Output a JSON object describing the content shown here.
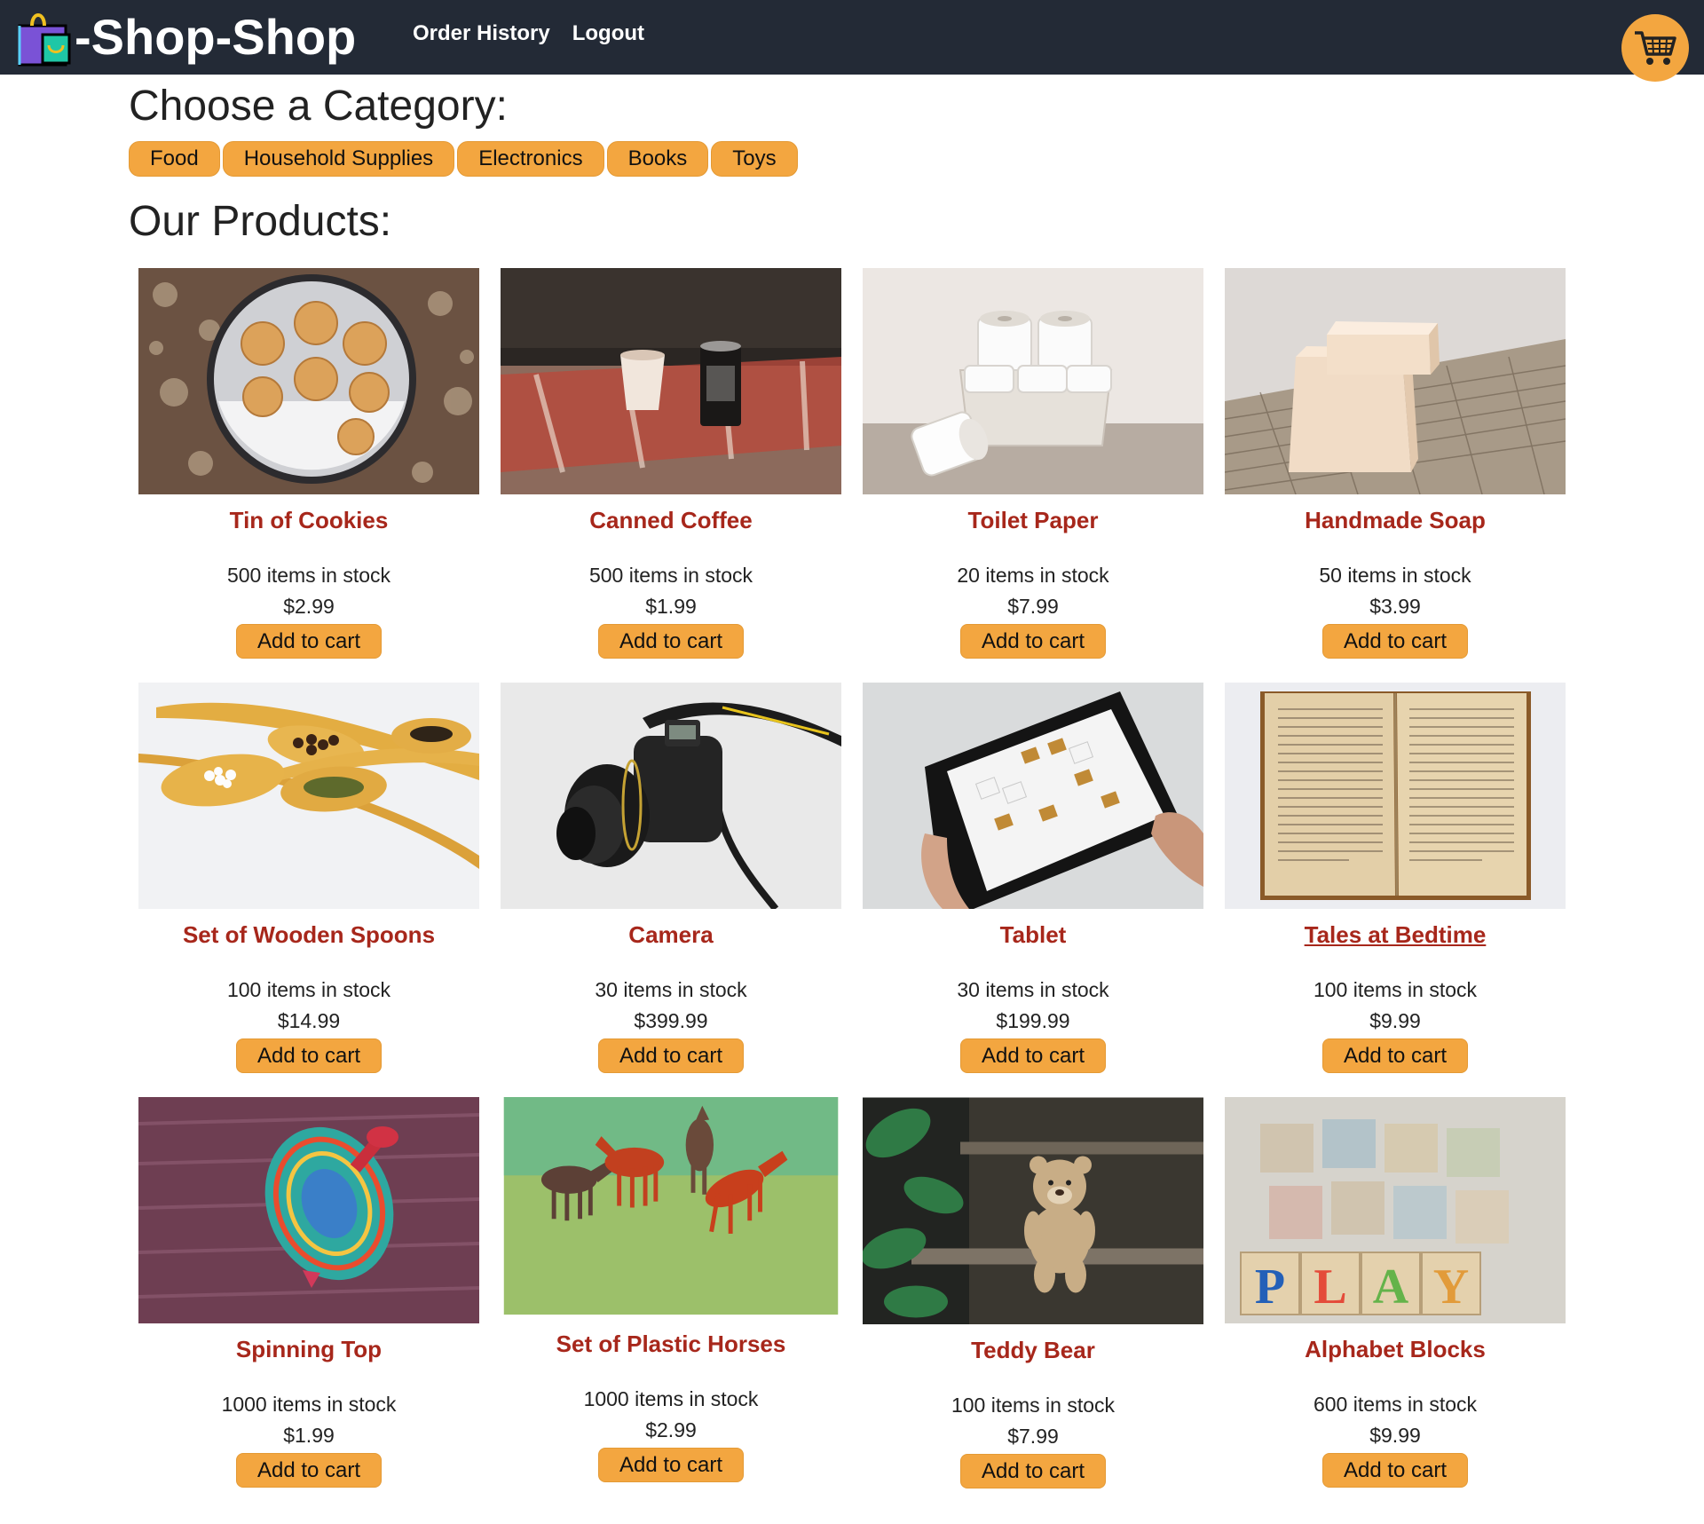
{
  "header": {
    "brand": "-Shop-Shop",
    "nav": [
      "Order History",
      "Logout"
    ],
    "cart_icon": "shopping-cart-icon",
    "logo_icon": "shopping-bag-icon",
    "colors": {
      "bar": "#232a36",
      "accent": "#f3a640",
      "product_name": "#a7271b"
    }
  },
  "categories": {
    "heading": "Choose a Category:",
    "items": [
      "Food",
      "Household Supplies",
      "Electronics",
      "Books",
      "Toys"
    ]
  },
  "products": {
    "heading": "Our Products:",
    "add_label": "Add to cart",
    "items": [
      {
        "name": "Tin of Cookies",
        "stock": "500 items in stock",
        "price": "$2.99",
        "image": "cookies-tin-image"
      },
      {
        "name": "Canned Coffee",
        "stock": "500 items in stock",
        "price": "$1.99",
        "image": "canned-coffee-image"
      },
      {
        "name": "Toilet Paper",
        "stock": "20 items in stock",
        "price": "$7.99",
        "image": "toilet-paper-image"
      },
      {
        "name": "Handmade Soap",
        "stock": "50 items in stock",
        "price": "$3.99",
        "image": "soap-image"
      },
      {
        "name": "Set of Wooden Spoons",
        "stock": "100 items in stock",
        "price": "$14.99",
        "image": "wooden-spoons-image"
      },
      {
        "name": "Camera",
        "stock": "30 items in stock",
        "price": "$399.99",
        "image": "camera-image"
      },
      {
        "name": "Tablet",
        "stock": "30 items in stock",
        "price": "$199.99",
        "image": "tablet-image"
      },
      {
        "name": "Tales at Bedtime",
        "stock": "100 items in stock",
        "price": "$9.99",
        "image": "book-image"
      },
      {
        "name": "Spinning Top",
        "stock": "1000 items in stock",
        "price": "$1.99",
        "image": "spinning-top-image"
      },
      {
        "name": "Set of Plastic Horses",
        "stock": "1000 items in stock",
        "price": "$2.99",
        "image": "plastic-horses-image"
      },
      {
        "name": "Teddy Bear",
        "stock": "100 items in stock",
        "price": "$7.99",
        "image": "teddy-bear-image"
      },
      {
        "name": "Alphabet Blocks",
        "stock": "600 items in stock",
        "price": "$9.99",
        "image": "alphabet-blocks-image"
      }
    ]
  }
}
